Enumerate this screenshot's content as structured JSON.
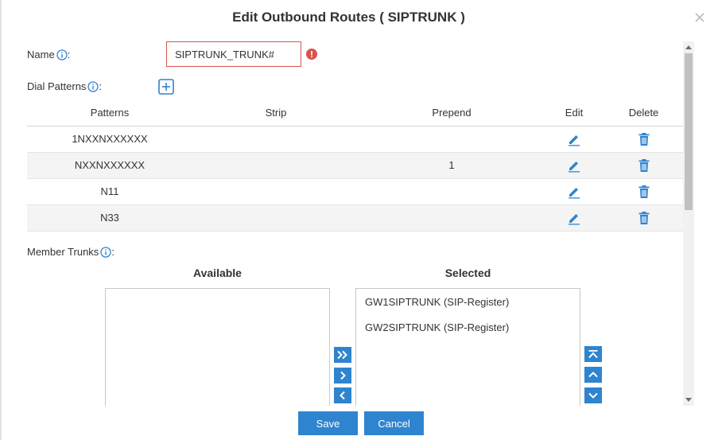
{
  "dialog": {
    "title": "Edit Outbound Routes ( SIPTRUNK )"
  },
  "form": {
    "name_label": "Name",
    "name_value": "SIPTRUNK_TRUNK#",
    "dial_patterns_label": "Dial Patterns",
    "member_trunks_label": "Member Trunks",
    "colon": ":"
  },
  "patterns_table": {
    "headers": [
      "Patterns",
      "Strip",
      "Prepend",
      "Edit",
      "Delete"
    ],
    "rows": [
      {
        "pattern": "1NXXNXXXXXX",
        "strip": "",
        "prepend": ""
      },
      {
        "pattern": "NXXNXXXXXX",
        "strip": "",
        "prepend": "1"
      },
      {
        "pattern": "N11",
        "strip": "",
        "prepend": ""
      },
      {
        "pattern": "N33",
        "strip": "",
        "prepend": ""
      }
    ]
  },
  "trunks": {
    "available_heading": "Available",
    "selected_heading": "Selected",
    "available": [],
    "selected": [
      "GW1SIPTRUNK (SIP-Register)",
      "GW2SIPTRUNK (SIP-Register)"
    ]
  },
  "footer": {
    "save_label": "Save",
    "cancel_label": "Cancel"
  },
  "colors": {
    "accent": "#2f84d0",
    "error": "#d9534f",
    "row_alt": "#f4f4f4"
  },
  "icons": {
    "close": "close-icon",
    "info": "info-icon",
    "error": "error-icon",
    "add": "add-square-icon",
    "edit": "pencil-icon",
    "delete": "trash-icon",
    "move_all_right": "double-chevron-right-icon",
    "move_right": "chevron-right-icon",
    "move_left": "chevron-left-icon",
    "move_top": "move-to-top-icon",
    "move_up": "chevron-up-icon",
    "move_down": "chevron-down-icon"
  }
}
